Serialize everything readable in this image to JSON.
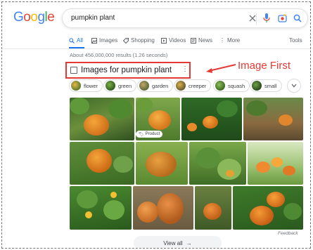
{
  "header": {
    "logo_letters": [
      {
        "char": "G",
        "color": "#4285F4"
      },
      {
        "char": "o",
        "color": "#EA4335"
      },
      {
        "char": "o",
        "color": "#FBBC05"
      },
      {
        "char": "g",
        "color": "#4285F4"
      },
      {
        "char": "l",
        "color": "#34A853"
      },
      {
        "char": "e",
        "color": "#EA4335"
      }
    ],
    "search_query": "pumpkin plant"
  },
  "tabs": [
    {
      "label": "All",
      "icon": "search-icon",
      "active": true
    },
    {
      "label": "Images",
      "icon": "image-icon"
    },
    {
      "label": "Shopping",
      "icon": "tag-icon"
    },
    {
      "label": "Videos",
      "icon": "video-icon"
    },
    {
      "label": "News",
      "icon": "news-icon"
    },
    {
      "label": "More",
      "icon": "more-vert-icon"
    },
    {
      "label": "Tools"
    }
  ],
  "results_count": "About 456,000,000 results (1.26 seconds)",
  "images_section": {
    "title": "Images for pumpkin plant",
    "annotation": "Image First",
    "product_badge": "Product",
    "feedback": "Feedback",
    "view_all": "View all"
  },
  "chips": [
    {
      "label": "flower",
      "color": "#7a8a3a"
    },
    {
      "label": "green",
      "color": "#3f7d2e"
    },
    {
      "label": "garden",
      "color": "#8c7a4a"
    },
    {
      "label": "creeper",
      "color": "#a38a40"
    },
    {
      "label": "squash",
      "color": "#4f7a2a"
    },
    {
      "label": "small",
      "color": "#5a8a3a"
    }
  ],
  "colors": {
    "accent_blue": "#1a73e8",
    "annotation_red": "#e53935"
  }
}
